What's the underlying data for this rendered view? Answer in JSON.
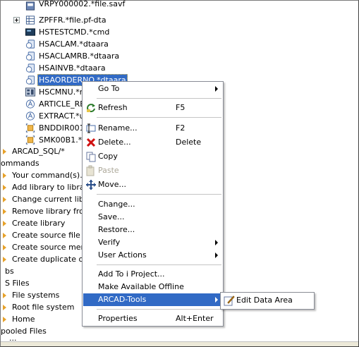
{
  "tree_top": [
    {
      "label": "VRPY000002.*file.savf"
    },
    {
      "label": "ZPFFR.*file.pf-dta"
    },
    {
      "label": "HSTESTCMD.*cmd"
    },
    {
      "label": "HSACLAM.*dtaara"
    },
    {
      "label": "HSACLAMRB.*dtaara"
    },
    {
      "label": "HSAINVB.*dtaara"
    },
    {
      "label": "HSAORDERNO.*dtaara"
    },
    {
      "label": "HSCMNU.*m"
    },
    {
      "label": "ARTICLE_RE"
    },
    {
      "label": "EXTRACT.*u"
    },
    {
      "label": "BNDDIR001."
    },
    {
      "label": "SMK00B1.*b"
    }
  ],
  "tree_lower": [
    {
      "label": "ARCAD_SQL/*"
    },
    {
      "label": "ommands"
    },
    {
      "label": "Your command(s)..."
    },
    {
      "label": "Add library to library"
    },
    {
      "label": "Change current libra"
    },
    {
      "label": "Remove library from"
    },
    {
      "label": "Create library"
    },
    {
      "label": "Create source file"
    },
    {
      "label": "Create source memb"
    },
    {
      "label": "Create duplicate obj"
    },
    {
      "label": "bs"
    },
    {
      "label": "S Files"
    },
    {
      "label": "File systems"
    },
    {
      "label": "Root file system"
    },
    {
      "label": "Home"
    },
    {
      "label": "pooled Files"
    },
    {
      "label": "..."
    }
  ],
  "menu": {
    "go_to": "Go To",
    "refresh": "Refresh",
    "refresh_key": "F5",
    "rename": "Rename...",
    "rename_key": "F2",
    "delete": "Delete...",
    "delete_key": "Delete",
    "copy": "Copy",
    "paste": "Paste",
    "move": "Move...",
    "change": "Change...",
    "save": "Save...",
    "restore": "Restore...",
    "verify": "Verify",
    "user_actions": "User Actions",
    "add_to_project": "Add To i Project...",
    "make_offline": "Make Available Offline",
    "arcad_tools": "ARCAD-Tools",
    "properties": "Properties",
    "properties_key": "Alt+Enter"
  },
  "submenu": {
    "edit_data_area": "Edit Data Area"
  },
  "colors": {
    "selection": "#316ac5",
    "folder": "#e6a12a"
  }
}
